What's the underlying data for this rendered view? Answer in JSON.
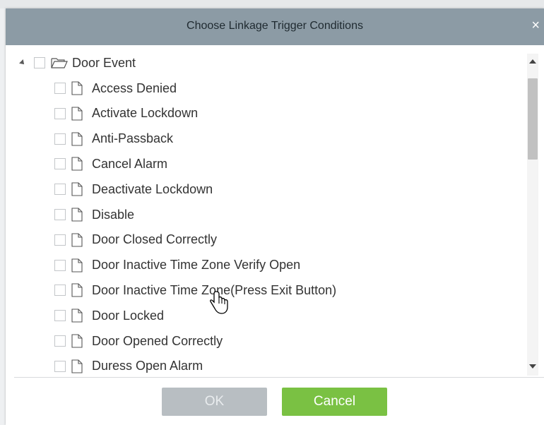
{
  "dialog": {
    "title": "Choose Linkage Trigger Conditions",
    "close_glyph": "×"
  },
  "tree": {
    "root": {
      "label": "Door Event",
      "expanded": true,
      "checked": false,
      "icon": "folder-open-icon"
    },
    "items": [
      {
        "label": "Access Denied",
        "checked": false,
        "icon": "file-icon"
      },
      {
        "label": "Activate Lockdown",
        "checked": false,
        "icon": "file-icon"
      },
      {
        "label": "Anti-Passback",
        "checked": false,
        "icon": "file-icon"
      },
      {
        "label": "Cancel Alarm",
        "checked": false,
        "icon": "file-icon"
      },
      {
        "label": "Deactivate Lockdown",
        "checked": false,
        "icon": "file-icon"
      },
      {
        "label": "Disable",
        "checked": false,
        "icon": "file-icon"
      },
      {
        "label": "Door Closed Correctly",
        "checked": false,
        "icon": "file-icon"
      },
      {
        "label": "Door Inactive Time Zone Verify Open",
        "checked": false,
        "icon": "file-icon"
      },
      {
        "label": "Door Inactive Time Zone(Press Exit Button)",
        "checked": false,
        "icon": "file-icon"
      },
      {
        "label": "Door Locked",
        "checked": false,
        "icon": "file-icon"
      },
      {
        "label": "Door Opened Correctly",
        "checked": false,
        "icon": "file-icon"
      },
      {
        "label": "Duress Open Alarm",
        "checked": false,
        "icon": "file-icon"
      }
    ]
  },
  "buttons": {
    "ok_label": "OK",
    "cancel_label": "Cancel"
  },
  "colors": {
    "titlebar": "#8c9ba5",
    "ok_disabled": "#b8bec2",
    "cancel": "#7ac143"
  }
}
